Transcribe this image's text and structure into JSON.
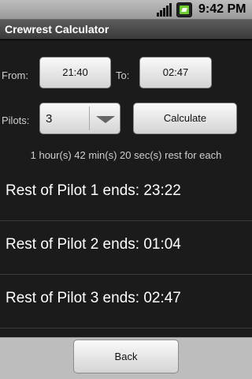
{
  "status_bar": {
    "time": "9:42 PM",
    "icons": [
      "signal-icon",
      "battery-icon"
    ]
  },
  "app": {
    "title": "Crewrest Calculator"
  },
  "form": {
    "from_label": "From:",
    "from_value": "21:40",
    "to_label": "To:",
    "to_value": "02:47",
    "pilots_label": "Pilots:",
    "pilots_value": "3",
    "calculate_label": "Calculate"
  },
  "summary": "1 hour(s) 42 min(s) 20 sec(s) rest for each",
  "results": [
    {
      "label": "Rest of Pilot 1 ends: 23:22"
    },
    {
      "label": "Rest of Pilot 2 ends: 01:04"
    },
    {
      "label": "Rest of Pilot 3 ends: 02:47"
    }
  ],
  "footer": {
    "back_label": "Back"
  }
}
